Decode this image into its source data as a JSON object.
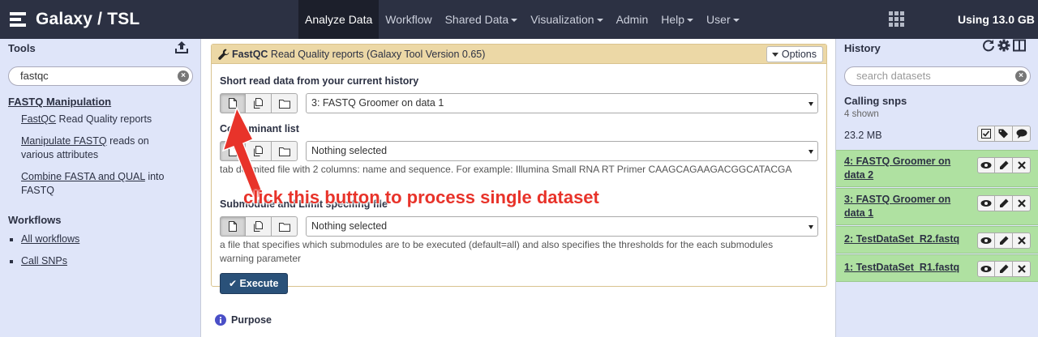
{
  "masthead": {
    "brand": "Galaxy / TSL",
    "nav": [
      {
        "label": "Analyze Data",
        "active": true,
        "dropdown": false
      },
      {
        "label": "Workflow",
        "active": false,
        "dropdown": false
      },
      {
        "label": "Shared Data",
        "active": false,
        "dropdown": true
      },
      {
        "label": "Visualization",
        "active": false,
        "dropdown": true
      },
      {
        "label": "Admin",
        "active": false,
        "dropdown": false
      },
      {
        "label": "Help",
        "active": false,
        "dropdown": true
      },
      {
        "label": "User",
        "active": false,
        "dropdown": true
      }
    ],
    "quota": "Using 13.0 GB",
    "apps_icon": "grid-icon"
  },
  "tools_panel": {
    "title": "Tools",
    "upload_icon": "upload-icon",
    "search_value": "fastqc",
    "section_title": "FASTQ Manipulation",
    "tools": [
      {
        "link": "FastQC",
        "rest": " Read Quality reports"
      },
      {
        "link": "Manipulate FASTQ",
        "rest": " reads on various attributes"
      },
      {
        "link": "Combine FASTA and QUAL",
        "rest": " into FASTQ"
      }
    ],
    "workflows_title": "Workflows",
    "workflows": [
      "All workflows",
      "Call SNPs"
    ]
  },
  "tool_form": {
    "name": "FastQC",
    "title_rest": " Read Quality reports (Galaxy Tool Version 0.65)",
    "options_label": "Options",
    "fields": [
      {
        "label": "Short read data from your current history",
        "value": "3: FASTQ Groomer on data 1",
        "help": ""
      },
      {
        "label": "Contaminant list",
        "value": "Nothing selected",
        "help": "tab delimited file with 2 columns: name and sequence. For example: Illumina Small RNA RT Primer CAAGCAGAAGACGGCATACGA"
      },
      {
        "label": "Submodule and Limit specifing file",
        "value": "Nothing selected",
        "help": "a file that specifies which submodules are to be executed (default=all) and also specifies the thresholds for the each submodules warning parameter"
      }
    ],
    "execute_label": "Execute",
    "purpose_label": "Purpose"
  },
  "annotation": {
    "text": "click this button to process single dataset",
    "color": "#e8332a"
  },
  "history": {
    "title": "History",
    "search_placeholder": "search datasets",
    "name": "Calling snps",
    "shown": "4 shown",
    "size": "23.2 MB",
    "datasets": [
      {
        "name": "4: FASTQ Groomer on data 2",
        "state": "ok"
      },
      {
        "name": "3: FASTQ Groomer on data 1",
        "state": "ok"
      },
      {
        "name": "2: TestDataSet_R2.fastq",
        "state": "ok"
      },
      {
        "name": "1: TestDataSet_R1.fastq",
        "state": "ok"
      }
    ]
  },
  "colors": {
    "masthead": "#2c3143",
    "panel": "#dfe5f9",
    "dataset_ok": "#afe1a1",
    "tool_header": "#ecd8a6",
    "execute": "#2a5179"
  }
}
